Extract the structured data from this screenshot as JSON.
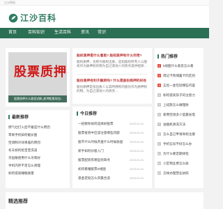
{
  "topbar": {
    "text": "江沙网站"
  },
  "brand": {
    "name": "江沙百科",
    "accent": "#2b6f55"
  },
  "nav": {
    "items": [
      "首页",
      "百科知识",
      "生活百科",
      "资讯",
      "常识"
    ]
  },
  "hero": {
    "image_text": "股票质押",
    "caption": "股票质押什么意思详解 (质押股票风险)",
    "article1_title": "股权质押是什么意思? 股权质押有什么作用?",
    "article1_body": "股权质押，也称为股权出质，是指股权所有人以股权作为质押标的物为自己或他人的债务提供担保…",
    "article2_title": "股份质押有利于融资吗? 什么是股份质押的好处",
    "article2_body": "股份质押是指出质人以其所拥有的股份作为质押标的物，为自己或他人的债务…"
  },
  "news": {
    "title": "今日推荐",
    "items": [
      {
        "text": "一招教你如何选择好股票",
        "date": "2023-01-01"
      },
      {
        "text": "股票投资中应该注意哪些问题",
        "date": "2023-01-01"
      },
      {
        "text": "股市什么时候开盘什么时候收盘",
        "date": "2023-01-01"
      },
      {
        "text": "新手如何炒股入门",
        "date": "2023-01-01"
      },
      {
        "text": "股票配资有哪些优缺点",
        "date": "2023-01-01"
      },
      {
        "text": "如何看懂股票K线图",
        "date": "2023-01-01"
      },
      {
        "text": "基金定投怎么买最合适",
        "date": "2023-01-01"
      }
    ]
  },
  "left_list": {
    "title": "最新推荐",
    "items": [
      "燃气灶打火后不着是什么原因",
      "苹果手机如何截长图",
      "空调制冷效果差的原因",
      "冬天如何给宝宝洗澡",
      "牙齿敏感用什么牙膏好",
      "手机内存不足怎么清理",
      "如何提高睡眠质量"
    ]
  },
  "hot": {
    "title": "热门推荐",
    "items": [
      "k线图什么意思怎么看",
      "借记卡和储蓄卡的区别",
      "五险一金包括哪些内容",
      "如何提高孩子的注意力",
      "上班族怎么做理财",
      "家用空调多少度最省电",
      "油烟机清洗方法",
      "怎么自己申请商标注册",
      "手机信号不好怎么办",
      "为什么要定期体检",
      "小区物业费怎么收",
      "怎样办理营业执照"
    ]
  },
  "footer": {
    "title": "精选推荐"
  }
}
